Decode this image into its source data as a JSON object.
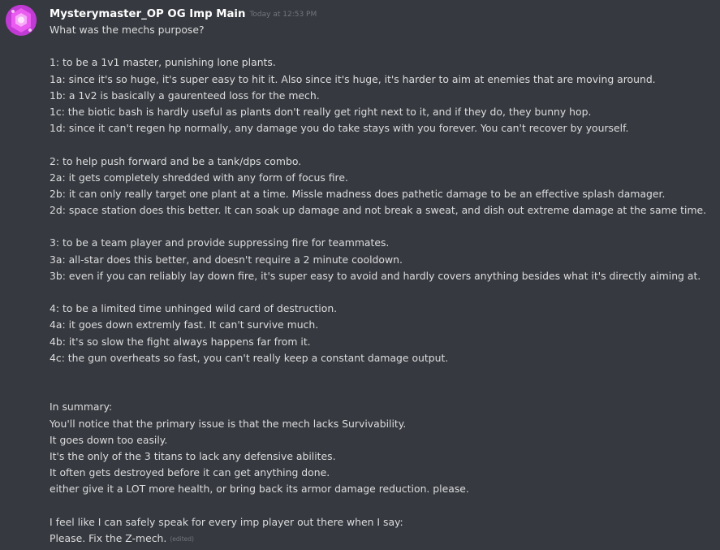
{
  "author": {
    "username": "Mysterymaster_OP OG Imp Main",
    "timestamp": "Today at 12:53 PM",
    "avatar_icon": "pink-hexagon-avatar",
    "avatar_colors": [
      "#c03ad4",
      "#ea5cf0",
      "#f7a8f9"
    ]
  },
  "message": {
    "lines": [
      "What was the mechs purpose?",
      "",
      "1: to be a 1v1 master, punishing lone plants.",
      "1a: since it's so huge, it's super easy to hit it. Also since it's huge, it's harder to aim at enemies that are moving around.",
      "1b: a 1v2 is basically a gaurenteed loss for the mech.",
      "1c: the biotic bash is hardly useful as plants don't really get right next to it, and if they do, they bunny hop.",
      "1d: since it can't regen hp normally, any damage you do take stays with you forever. You can't recover by yourself.",
      "",
      "2: to help push forward and be a tank/dps combo.",
      "2a: it gets completely shredded with any form of focus fire.",
      "2b: it can only really target one plant at a time. Missle madness does pathetic damage to be an effective splash damager.",
      "2d: space station does this better. It can soak up damage and not break a sweat, and dish out extreme damage at the same time.",
      "",
      "3: to be a team player and provide suppressing fire for teammates.",
      "3a: all-star does this better, and doesn't require a 2 minute cooldown.",
      "3b: even if you can reliably lay down fire, it's super easy to avoid and hardly covers anything besides what it's directly aiming at.",
      "",
      "4: to be a limited time unhinged wild card of destruction.",
      "4a: it goes down extremly fast. It can't survive much.",
      "4b: it's so slow the fight always happens far from it.",
      "4c: the gun overheats so fast, you can't really keep a constant damage output.",
      "",
      "",
      "In summary:",
      "You'll notice that the primary issue is that the mech lacks Survivability.",
      "It goes down too easily.",
      "It's the only of the 3 titans to lack any defensive abilites.",
      "It often gets destroyed before it can get anything done.",
      "either give it a LOT more health, or bring back its armor damage reduction. please.",
      "",
      "I feel like I can safely speak for every imp player out there when I say:",
      "Please. Fix the Z-mech."
    ],
    "edited_label": "(edited)"
  }
}
